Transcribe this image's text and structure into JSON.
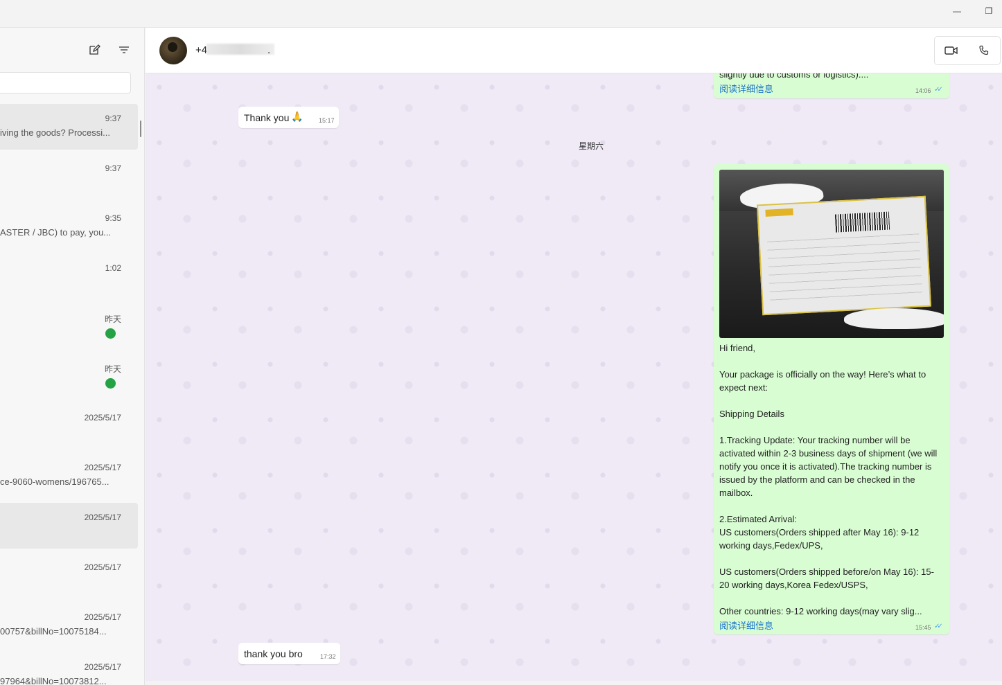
{
  "window": {
    "minimize_glyph": "—",
    "restore_glyph": "❐"
  },
  "sidebar": {
    "new_chat_icon": "compose-icon",
    "filter_icon": "filter-icon",
    "chats": [
      {
        "time": "9:37",
        "preview": "iving the goods? Processi..."
      },
      {
        "time": "9:37",
        "preview": ""
      },
      {
        "time": "9:35",
        "preview": "ASTER / JBC) to pay, you..."
      },
      {
        "time": "1:02",
        "preview": ""
      },
      {
        "time": "昨天",
        "preview": ""
      },
      {
        "time": "昨天",
        "preview": ""
      },
      {
        "time": "2025/5/17",
        "preview": ""
      },
      {
        "time": "2025/5/17",
        "preview": "ce-9060-womens/196765..."
      },
      {
        "time": "2025/5/17",
        "preview": ""
      },
      {
        "time": "2025/5/17",
        "preview": ""
      },
      {
        "time": "2025/5/17",
        "preview": "00757&billNo=10075184..."
      },
      {
        "time": "2025/5/17",
        "preview": "97964&billNo=10073812..."
      }
    ]
  },
  "header": {
    "contact_prefix": "+4",
    "contact_suffix": ".",
    "video_icon": "video-call-icon",
    "phone_icon": "phone-call-icon"
  },
  "messages": {
    "top_out": {
      "text": "slightly due to customs or logistics)....",
      "read_more": "阅读详细信息",
      "time": "14:06"
    },
    "in1": {
      "text": "Thank you",
      "emoji": "🙏",
      "time": "15:17"
    },
    "date_divider": "星期六",
    "shipping": {
      "greeting": "Hi friend,",
      "p1": "Your package is officially on the way!  Here’s what to expect next:",
      "p2": "Shipping Details",
      "p3": "1.Tracking Update: Your tracking number will be activated within 2-3 business days of shipment (we will notify you once it is activated).The tracking number is issued by the platform and can be checked in the mailbox.",
      "p4a": "2.Estimated Arrival:",
      "p4b": "US customers(Orders shipped after May 16): 9-12 working days,Fedex/UPS,",
      "p5": "US customers(Orders shipped before/on May 16): 15-20 working days,Korea Fedex/USPS,",
      "p6": "Other countries: 9-12 working days(may vary slig...",
      "read_more": "阅读详细信息",
      "time": "15:45"
    },
    "in2": {
      "text": "thank you bro",
      "time": "17:32"
    }
  },
  "colors": {
    "outgoing_bubble": "#d9fdd3",
    "incoming_bubble": "#ffffff",
    "unread_badge": "#25a244",
    "link": "#1a73c9",
    "read_ticks": "#4fa3e3"
  }
}
